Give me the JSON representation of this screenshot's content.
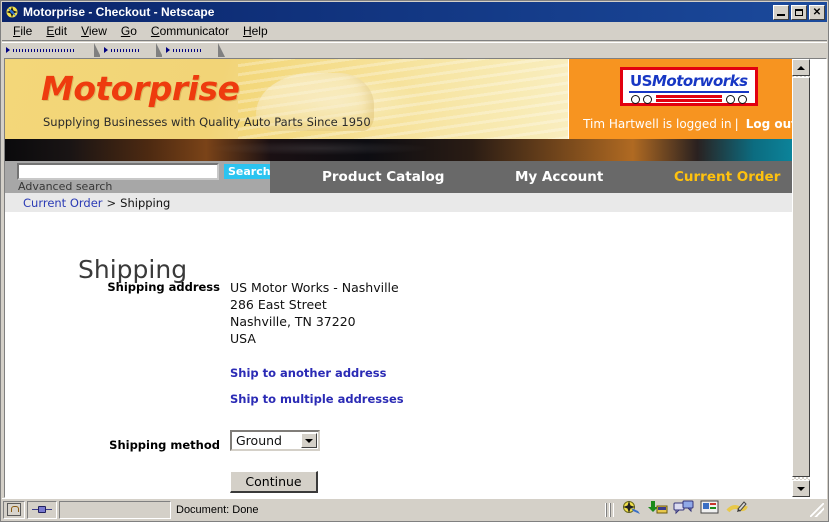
{
  "window": {
    "title": "Motorprise - Checkout - Netscape",
    "minimize_label": "Minimize",
    "maximize_label": "Maximize",
    "close_label": "✕"
  },
  "menubar": {
    "items": [
      {
        "label": "File",
        "accel": "F"
      },
      {
        "label": "Edit",
        "accel": "E"
      },
      {
        "label": "View",
        "accel": "V"
      },
      {
        "label": "Go",
        "accel": "G"
      },
      {
        "label": "Communicator",
        "accel": "C"
      },
      {
        "label": "Help",
        "accel": "H"
      }
    ]
  },
  "banner": {
    "brand": "Motorprise",
    "tagline": "Supplying Businesses with Quality Auto Parts Since 1950",
    "customer_logo": {
      "prefix": "US",
      "suffix": "Motorworks"
    },
    "session": {
      "logged_in_text": "Tim Hartwell is logged in",
      "separator": "|",
      "logout_label": "Log out"
    },
    "colors": {
      "banner_bg": "#f3d779",
      "brand_red": "#ee3b0e",
      "orange_panel": "#f79420",
      "logo_blue": "#1737c4",
      "logo_red": "#e2000f"
    }
  },
  "search": {
    "value": "",
    "placeholder": "",
    "button_label": "Search",
    "advanced_label": "Advanced search",
    "button_color": "#2bc4f0"
  },
  "nav": {
    "items": [
      {
        "label": "Product Catalog",
        "active": false
      },
      {
        "label": "My Account",
        "active": false
      },
      {
        "label": "Current Order",
        "active": true
      }
    ],
    "active_color": "#ffc20e",
    "bar_color": "#696969"
  },
  "breadcrumb": {
    "link": "Current Order",
    "separator": ">",
    "current": "Shipping"
  },
  "main": {
    "page_title": "Shipping",
    "shipping_address": {
      "label": "Shipping address",
      "line1": "US Motor Works - Nashville",
      "line2": "286 East Street",
      "line3": "Nashville, TN 37220",
      "line4": "USA"
    },
    "links": {
      "another_address": "Ship to another address",
      "multiple_addresses": "Ship to multiple addresses"
    },
    "shipping_method": {
      "label": "Shipping method",
      "selected": "Ground",
      "options": [
        "Ground"
      ]
    },
    "continue_label": "Continue"
  },
  "statusbar": {
    "document_status": "Document: Done"
  }
}
